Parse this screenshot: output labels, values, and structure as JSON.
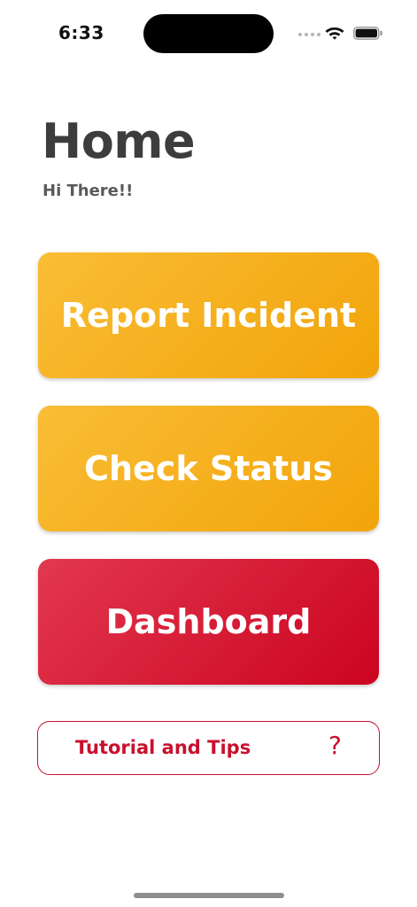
{
  "status_bar": {
    "time": "6:33"
  },
  "header": {
    "title": "Home",
    "greeting": "Hi There!!"
  },
  "actions": {
    "report_incident": "Report Incident",
    "check_status": "Check Status",
    "dashboard": "Dashboard"
  },
  "tutorial": {
    "label": "Tutorial and Tips",
    "icon": "?"
  },
  "colors": {
    "primary_yellow": "#f2a40a",
    "primary_red": "#cc0420",
    "title_gray": "#3d3d3f"
  }
}
